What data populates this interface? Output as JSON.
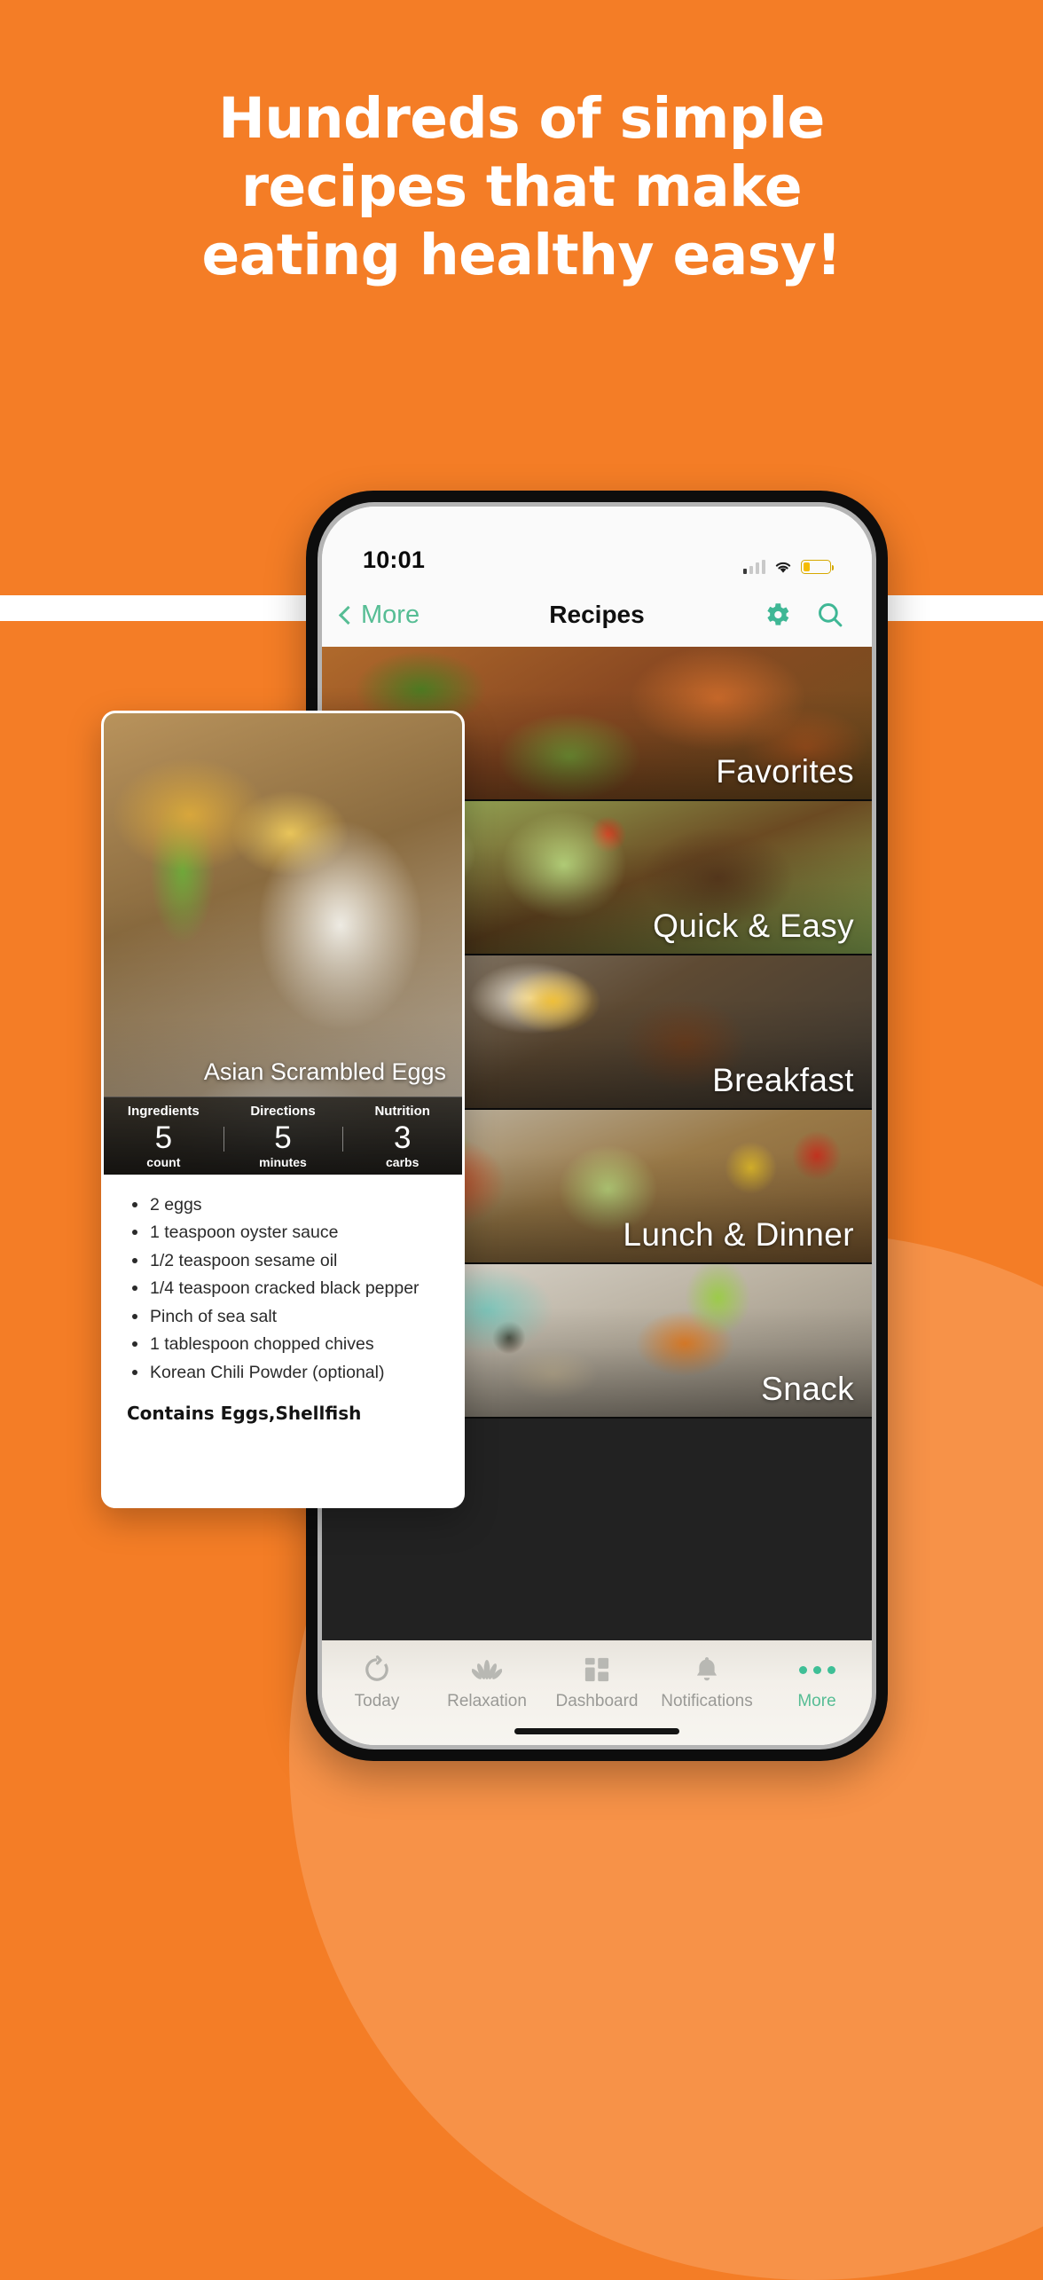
{
  "background": {
    "orange": "#F47D26",
    "arc_orange": "#F79248",
    "band_color": "#FFFFFF"
  },
  "headline": {
    "lines": [
      "Hundreds of simple",
      "recipes that make",
      "eating healthy easy!"
    ],
    "color": "#FFFFFF"
  },
  "phone": {
    "status_bar": {
      "time": "10:01",
      "signal_icon": "cellular-signal-icon",
      "wifi_icon": "wifi-icon",
      "battery_icon": "battery-low-icon"
    },
    "nav_bar": {
      "back_label": "More",
      "back_icon": "chevron-left-icon",
      "title": "Recipes",
      "settings_icon": "gear-icon",
      "search_icon": "search-icon",
      "accent_color": "#56BD94"
    },
    "categories": [
      {
        "label": "Favorites"
      },
      {
        "label": "Quick & Easy"
      },
      {
        "label": "Breakfast"
      },
      {
        "label": "Lunch & Dinner"
      },
      {
        "label": "Snack"
      }
    ],
    "tab_bar": {
      "items": [
        {
          "label": "Today",
          "icon": "refresh-circle-icon",
          "active": false
        },
        {
          "label": "Relaxation",
          "icon": "lotus-icon",
          "active": false
        },
        {
          "label": "Dashboard",
          "icon": "grid-icon",
          "active": false
        },
        {
          "label": "Notifications",
          "icon": "bell-icon",
          "active": false
        },
        {
          "label": "More",
          "icon": "three-dots-icon",
          "active": true
        }
      ],
      "active_color": "#56BD94",
      "inactive_color": "#9A9A96"
    }
  },
  "recipe_card": {
    "title": "Asian Scrambled Eggs",
    "stats": [
      {
        "heading": "Ingredients",
        "value": "5",
        "unit": "count"
      },
      {
        "heading": "Directions",
        "value": "5",
        "unit": "minutes"
      },
      {
        "heading": "Nutrition",
        "value": "3",
        "unit": "carbs"
      }
    ],
    "ingredients": [
      "2 eggs",
      "1 teaspoon oyster sauce",
      "1/2 teaspoon sesame oil",
      "1/4 teaspoon cracked black pepper",
      "Pinch of sea salt",
      "1 tablespoon chopped chives",
      "Korean Chili Powder (optional)"
    ],
    "allergen_note": "Contains Eggs,Shellfish"
  }
}
